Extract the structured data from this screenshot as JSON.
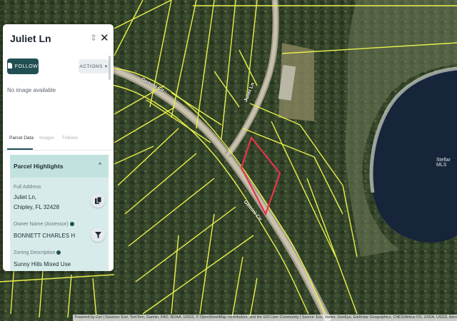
{
  "panel": {
    "title": "Juliet Ln",
    "follow_label": "FOLLOW",
    "actions_label": "ACTIONS",
    "no_image_text": "No image available",
    "tabs": [
      {
        "label": "Parcel Data",
        "active": true
      },
      {
        "label": "Images",
        "active": false
      },
      {
        "label": "Follows",
        "active": false
      }
    ],
    "section_title": "Parcel Highlights",
    "fields": {
      "address_label": "Full Address",
      "address_line1": "Juliet Ln,",
      "address_line2": "Chipley, FL 32428",
      "owner_label": "Owner Name (Assessor)",
      "owner_value": "BONNETT CHARLES H",
      "zoning_label": "Zoning Description",
      "zoning_value": "Sunny Hills Mixed Use"
    }
  },
  "map": {
    "road_labels": [
      "Gemini Cir",
      "Juliet Ln",
      "Gemini Cir"
    ],
    "watermark": "Stellar MLS",
    "attribution": "Powered by Esri | Sources: Esri, TomTom, Garmin, FAO, NOAA, USGS, © OpenStreetMap contributors, and the GIS User Community | Source: Esri, Vantor, GeoEye, Earthstar Geographics, CNES/Airbus DS, USDA, USGS, Aero",
    "colors": {
      "parcel_lines": "#e8f04a",
      "selected_parcel": "#e8334a",
      "water": "#16253a",
      "panel_accent": "#214f53"
    }
  }
}
